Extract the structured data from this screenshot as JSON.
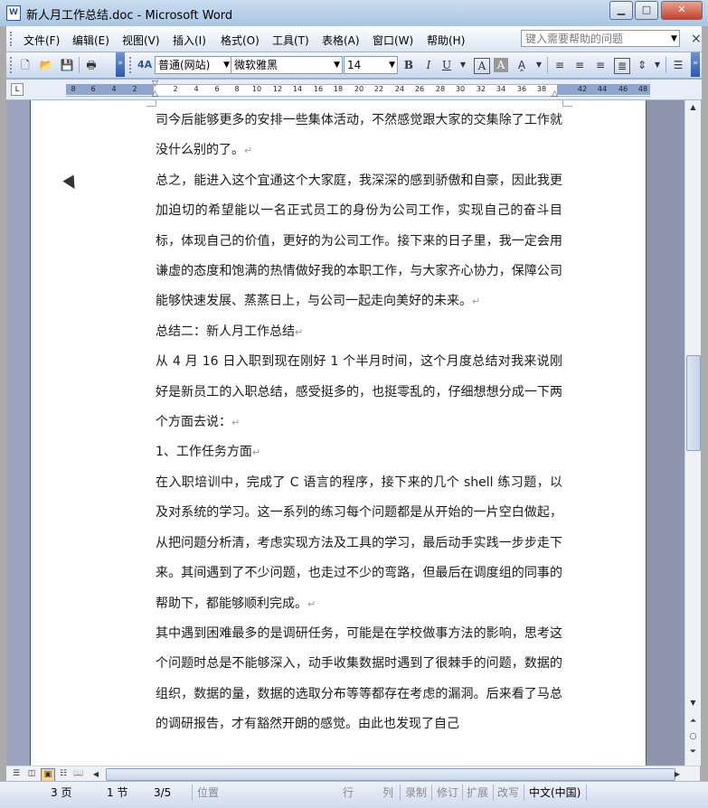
{
  "window": {
    "title": "新人月工作总结.doc - Microsoft Word",
    "buttons": {
      "minimize": "▁",
      "maximize": "□",
      "close": "✕"
    }
  },
  "menu": {
    "items": [
      "文件(F)",
      "编辑(E)",
      "视图(V)",
      "插入(I)",
      "格式(O)",
      "工具(T)",
      "表格(A)",
      "窗口(W)",
      "帮助(H)"
    ],
    "help_placeholder": "键入需要帮助的问题",
    "close_glyph": "×"
  },
  "toolbar": {
    "style": "普通(网站)",
    "font": "微软雅黑",
    "size": "14",
    "bold": "B",
    "italic": "I",
    "underline": "U",
    "text_a1": "A",
    "text_a2": "A",
    "icons": [
      "new-document-icon",
      "open-folder-icon",
      "save-icon",
      "print-icon",
      "styles-icon",
      "char-spacing-icon",
      "align-left-icon",
      "align-center-icon",
      "align-right-icon",
      "justify-icon",
      "line-spacing-icon",
      "numbering-icon"
    ]
  },
  "ruler": {
    "corner": "L",
    "left_numbers": [
      "8",
      "6",
      "4",
      "2"
    ],
    "right_numbers": [
      "2",
      "4",
      "6",
      "8",
      "10",
      "12",
      "14",
      "16",
      "18",
      "20",
      "22",
      "24",
      "26",
      "28",
      "30",
      "32",
      "34",
      "36",
      "38",
      "42",
      "44",
      "46",
      "48"
    ]
  },
  "document": {
    "paragraphs": [
      {
        "text": "司今后能够更多的安排一些集体活动，不然感觉跟大家的交集除了工作就没什么别的了。",
        "mark": "↵"
      },
      {
        "text": "总之，能进入这个宜通这个大家庭，我深深的感到骄傲和自豪，因此我更加迫切的希望能以一名正式员工的身份为公司工作，实现自己的奋斗目标，体现自己的价值，更好的为公司工作。接下来的日子里，我一定会用谦虚的态度和饱满的热情做好我的本职工作，与大家齐心协力，保障公司能够快速发展、蒸蒸日上，与公司一起走向美好的未来。",
        "mark": "↵"
      },
      {
        "text": "总结二：新人月工作总结",
        "mark": "↵"
      },
      {
        "text": "从 4 月 16 日入职到现在刚好 1 个半月时间，这个月度总结对我来说刚好是新员工的入职总结，感受挺多的，也挺零乱的，仔细想想分成一下两个方面去说：",
        "mark": "↵"
      },
      {
        "text": "1、工作任务方面",
        "mark": "↵"
      },
      {
        "text": "在入职培训中，完成了 C 语言的程序，接下来的几个 shell 练习题，以及对系统的学习。这一系列的练习每个问题都是从开始的一片空白做起，从把问题分析清，考虑实现方法及工具的学习，最后动手实践一步步走下来。其间遇到了不少问题，也走过不少的弯路，但最后在调度组的同事的帮助下，都能够顺利完成。",
        "mark": "↵"
      },
      {
        "text": "其中遇到困难最多的是调研任务，可能是在学校做事方法的影响，思考这个问题时总是不能够深入，动手收集数据时遇到了很棘手的问题，数据的组织，数据的量，数据的选取分布等等都存在考虑的漏洞。后来看了马总的调研报告，才有豁然开朗的感觉。由此也发现了自己",
        "mark": ""
      }
    ]
  },
  "status": {
    "page": "3 页",
    "section": "1 节",
    "page_of": "3/5",
    "position": "位置",
    "line": "行",
    "column": "列",
    "record": "录制",
    "revise": "修订",
    "extend": "扩展",
    "overtype": "改写",
    "language": "中文(中国)"
  }
}
